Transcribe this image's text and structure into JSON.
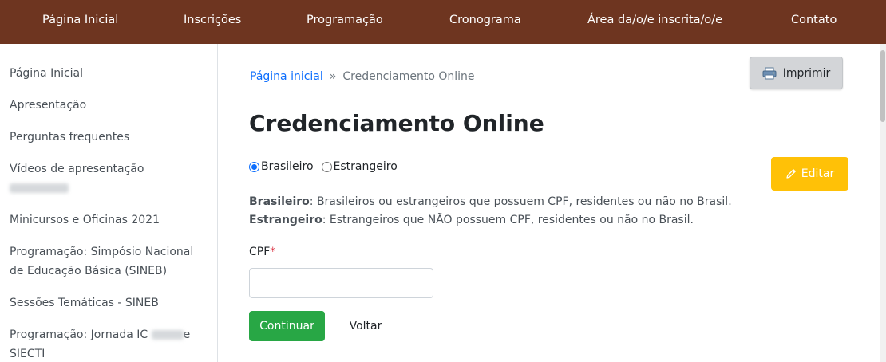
{
  "topnav": {
    "items": [
      "Página Inicial",
      "Inscrições",
      "Programação",
      "Cronograma",
      "Área da/o/e inscrita/o/e",
      "Contato"
    ]
  },
  "sidebar": {
    "items": [
      "Página Inicial",
      "Apresentação",
      "Perguntas frequentes",
      "Vídeos de apresentação",
      "Minicursos e Oficinas 2021",
      "Programação: Simpósio Nacional",
      "de Educação Básica (SINEB)",
      "Sessões Temáticas - SINEB",
      "Programação: Jornada IC",
      "e",
      "SIECTI"
    ]
  },
  "breadcrumb": {
    "home": "Página inicial",
    "separator": "»",
    "current": "Credenciamento Online"
  },
  "print_button": "Imprimir",
  "title": "Credenciamento Online",
  "radios": {
    "options": [
      "Brasileiro",
      "Estrangeiro"
    ],
    "selected": "Brasileiro"
  },
  "edit_button": "Editar",
  "descriptions": [
    {
      "term": "Brasileiro",
      "text": ": Brasileiros ou estrangeiros que possuem CPF, residentes ou não no Brasil."
    },
    {
      "term": "Estrangeiro",
      "text": ": Estrangeiros que NÃO possuem CPF, residentes ou não no Brasil."
    }
  ],
  "form": {
    "cpf_label": "CPF",
    "required_mark": "*",
    "cpf_value": "",
    "continue_button": "Continuar",
    "back_button": "Voltar"
  },
  "colors": {
    "nav_background": "#6e3520",
    "link": "#0d6efd",
    "edit": "#ffc107",
    "continue": "#28a745"
  }
}
